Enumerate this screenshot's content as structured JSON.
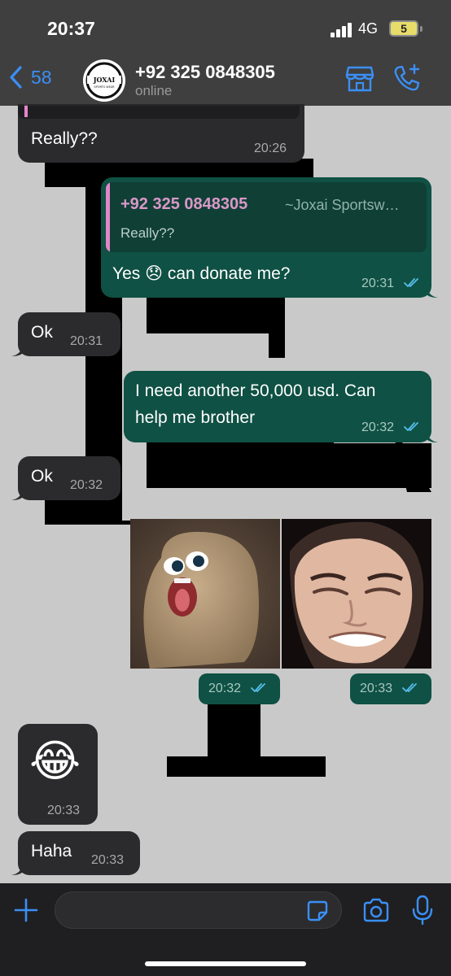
{
  "status_bar": {
    "time": "20:37",
    "network": "4G",
    "battery": "5"
  },
  "header": {
    "back_count": "58",
    "contact_name": "+92 325 0848305",
    "contact_status": "online",
    "avatar_text": "JOXAI",
    "avatar_subtext": "SPORTS WEAR"
  },
  "messages": [
    {
      "direction": "in",
      "text": "Really??",
      "time": "20:26"
    },
    {
      "direction": "out",
      "quote": {
        "name": "+92 325 0848305",
        "business": "~Joxai Sportsw…",
        "text": "Really??"
      },
      "text": "Yes 😞 can donate me?",
      "time": "20:31",
      "status": "read"
    },
    {
      "direction": "in",
      "text": "Ok",
      "time": "20:31"
    },
    {
      "direction": "out",
      "text": "I need another 50,000 usd. Can help me brother",
      "line1": "I need another 50,000 usd. Can",
      "line2": "help me brother",
      "time": "20:32",
      "status": "read"
    },
    {
      "direction": "in",
      "text": "Ok",
      "time": "20:32"
    },
    {
      "direction": "out",
      "type": "image",
      "image": "potato-face-photo",
      "time": "20:32",
      "status": "read"
    },
    {
      "direction": "out",
      "type": "image",
      "image": "man-squinting-photo",
      "time": "20:33",
      "status": "read"
    },
    {
      "direction": "in",
      "text": "😂",
      "time": "20:33"
    },
    {
      "direction": "in",
      "text": "Haha",
      "time": "20:33"
    }
  ],
  "colors": {
    "accent": "#3b8ff5",
    "incoming_bubble": "#2b2b2d",
    "outgoing_bubble": "#0f5144",
    "quote_author": "#d998c8",
    "read_ticks": "#53bdeb",
    "wallpaper": "#c9c9c9"
  }
}
